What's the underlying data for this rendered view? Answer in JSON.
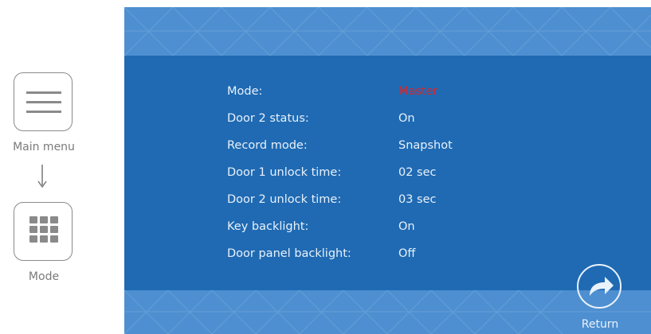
{
  "sidebar": {
    "main_menu_label": "Main menu",
    "mode_label": "Mode",
    "main_menu_icon": "hamburger-icon",
    "mode_icon": "grid-icon",
    "arrow_icon": "arrow-down-icon"
  },
  "settings": {
    "rows": [
      {
        "label": "Mode:",
        "value": "Master",
        "accent": true
      },
      {
        "label": "Door 2 status:",
        "value": "On"
      },
      {
        "label": "Record mode:",
        "value": "Snapshot"
      },
      {
        "label": "Door 1 unlock time:",
        "value": "02 sec"
      },
      {
        "label": "Door 2 unlock time:",
        "value": "03 sec"
      },
      {
        "label": "Key backlight:",
        "value": "On"
      },
      {
        "label": "Door panel backlight:",
        "value": "Off"
      }
    ]
  },
  "footer": {
    "return_label": "Return",
    "return_icon": "return-arrow-icon"
  },
  "colors": {
    "screen_bg": "#1f6ab3",
    "band_bg": "#4d8fd0",
    "text": "#e9f1fa",
    "accent": "#d9252b"
  }
}
